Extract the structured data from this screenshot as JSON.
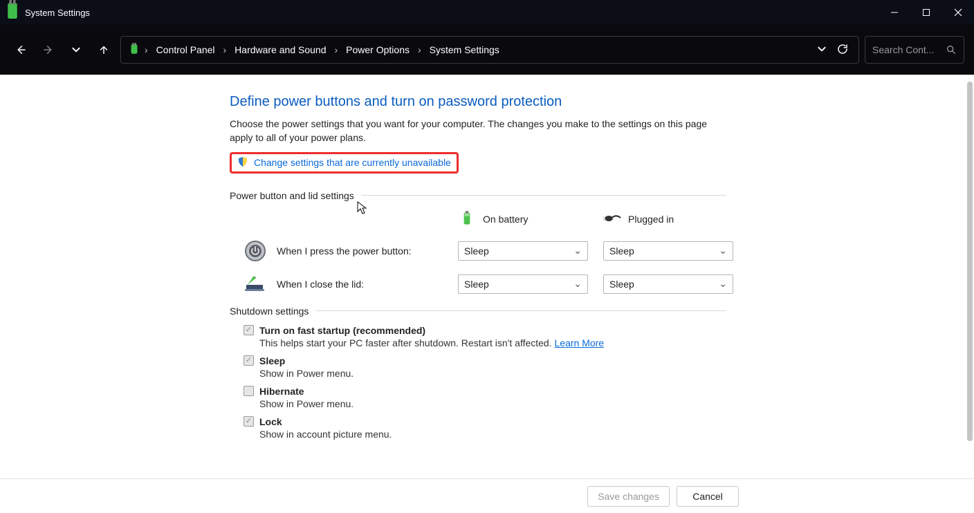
{
  "titlebar": {
    "title": "System Settings"
  },
  "breadcrumbs": {
    "items": [
      "Control Panel",
      "Hardware and Sound",
      "Power Options",
      "System Settings"
    ]
  },
  "search": {
    "placeholder": "Search Cont..."
  },
  "page": {
    "title": "Define power buttons and turn on password protection",
    "subtitle": "Choose the power settings that you want for your computer. The changes you make to the settings on this page apply to all of your power plans.",
    "uac_link": "Change settings that are currently unavailable"
  },
  "sections": {
    "power_button": {
      "label": "Power button and lid settings",
      "col_battery": "On battery",
      "col_plugged": "Plugged in",
      "rows": {
        "press_power": {
          "label": "When I press the power button:",
          "battery": "Sleep",
          "plugged": "Sleep"
        },
        "close_lid": {
          "label": "When I close the lid:",
          "battery": "Sleep",
          "plugged": "Sleep"
        }
      }
    },
    "shutdown": {
      "label": "Shutdown settings",
      "items": {
        "fast_startup": {
          "title": "Turn on fast startup (recommended)",
          "desc": "This helps start your PC faster after shutdown. Restart isn't affected. ",
          "learn_more": "Learn More",
          "checked": true
        },
        "sleep": {
          "title": "Sleep",
          "desc": "Show in Power menu.",
          "checked": true
        },
        "hibernate": {
          "title": "Hibernate",
          "desc": "Show in Power menu.",
          "checked": false
        },
        "lock": {
          "title": "Lock",
          "desc": "Show in account picture menu.",
          "checked": true
        }
      }
    }
  },
  "footer": {
    "save": "Save changes",
    "cancel": "Cancel"
  }
}
